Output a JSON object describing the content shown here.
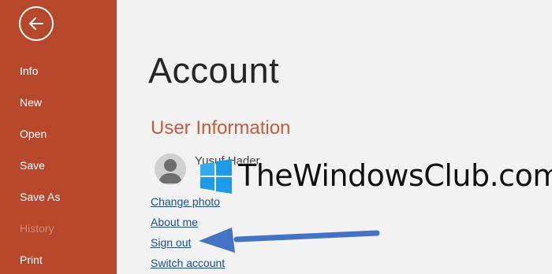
{
  "sidebar": {
    "accent_color": "#b7472a",
    "back_icon": "back-arrow-icon",
    "items": [
      {
        "label": "Info",
        "enabled": true
      },
      {
        "label": "New",
        "enabled": true
      },
      {
        "label": "Open",
        "enabled": true
      },
      {
        "label": "Save",
        "enabled": true
      },
      {
        "label": "Save As",
        "enabled": true
      },
      {
        "label": "History",
        "enabled": false
      },
      {
        "label": "Print",
        "enabled": true
      }
    ]
  },
  "main": {
    "title": "Account",
    "section_title": "User Information",
    "user_name": "Yusuf Hader",
    "avatar_icon": "user-avatar-icon",
    "links": {
      "change_photo": "Change photo",
      "about_me": "About me",
      "sign_out": "Sign out",
      "switch_account": "Switch account"
    },
    "annotation_arrow_color": "#4472c4"
  },
  "watermark": {
    "text": "TheWindowsClub.com",
    "logo_icon": "windows-logo-icon"
  }
}
